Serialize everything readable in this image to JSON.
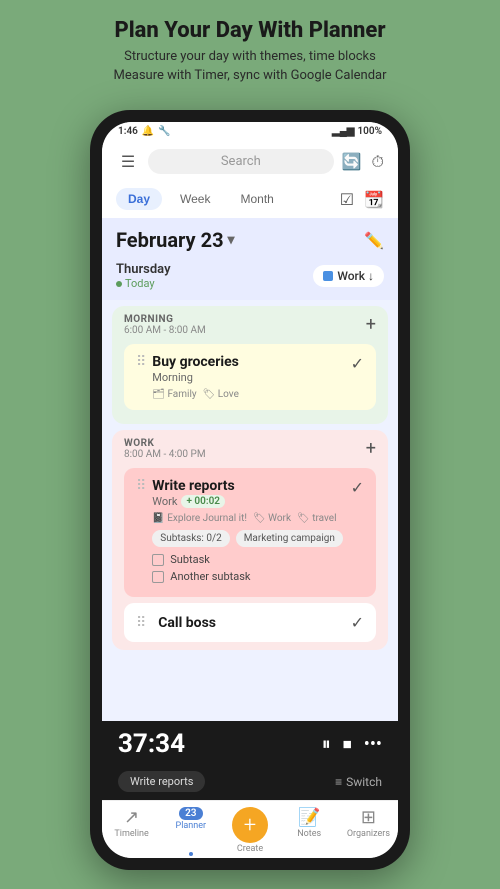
{
  "header": {
    "title": "Plan Your Day With Planner",
    "subtitle_line1": "Structure your day with themes, time blocks",
    "subtitle_line2": "Measure with Timer, sync with Google Calendar"
  },
  "status_bar": {
    "time": "1:46",
    "battery": "100%"
  },
  "top_nav": {
    "search_placeholder": "Search"
  },
  "tabs": {
    "day_label": "Day",
    "week_label": "Week",
    "month_label": "Month"
  },
  "date_section": {
    "date": "February 23",
    "day_name": "Thursday",
    "today_label": "Today",
    "work_label": "Work ↓"
  },
  "morning_section": {
    "name": "MORNING",
    "time_range": "6:00 AM - 8:00 AM",
    "tasks": [
      {
        "name": "Buy groceries",
        "sub": "Morning",
        "tags": [
          "Family",
          "Love"
        ],
        "checked": true
      }
    ]
  },
  "work_section": {
    "name": "WORK",
    "time_range": "8:00 AM - 4:00 PM",
    "tasks": [
      {
        "name": "Write reports",
        "sub": "Work",
        "time_badge": "+ 00:02",
        "journals": [
          "Explore Journal it!",
          "Work",
          "travel"
        ],
        "subtask_pills": [
          "Subtasks: 0/2",
          "Marketing campaign"
        ],
        "subtasks": [
          "Subtask",
          "Another subtask"
        ],
        "checked": true
      },
      {
        "name": "Call boss",
        "checked": true
      }
    ]
  },
  "timer": {
    "display": "37:34",
    "task_label": "Write reports"
  },
  "bottom_nav": {
    "items": [
      {
        "label": "Timeline",
        "icon": "↗"
      },
      {
        "label": "Planner",
        "icon": "📅",
        "badge": "23",
        "active": true
      },
      {
        "label": "Create",
        "icon": "+"
      },
      {
        "label": "Notes",
        "icon": "📝"
      },
      {
        "label": "Organizers",
        "icon": "⊞"
      }
    ]
  }
}
